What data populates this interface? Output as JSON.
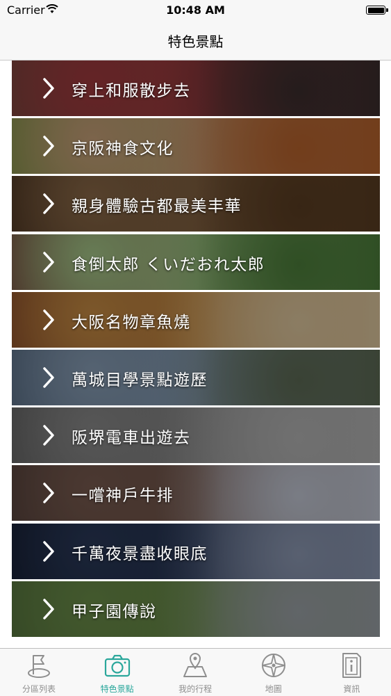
{
  "status_bar": {
    "carrier": "Carrier",
    "time": "10:48 AM"
  },
  "nav_bar": {
    "title": "特色景點"
  },
  "attractions": [
    {
      "label": "穿上和服散步去",
      "colors": [
        "#6f4a3d",
        "#a23a3e",
        "#3c2e2e"
      ]
    },
    {
      "label": "京阪神食文化",
      "colors": [
        "#6e8f3b",
        "#c9a27a",
        "#b8632d"
      ]
    },
    {
      "label": "親身體驗古都最美丰華",
      "colors": [
        "#3a2618",
        "#8c6a48",
        "#5a3d22"
      ]
    },
    {
      "label": "食倒太郎 くいだおれ太郎",
      "colors": [
        "#6b2b2b",
        "#a7c98a",
        "#4d7f3b"
      ]
    },
    {
      "label": "大阪名物章魚燒",
      "colors": [
        "#7a3b22",
        "#c98e45",
        "#e0c9a0"
      ]
    },
    {
      "label": "萬城目學景點遊歷",
      "colors": [
        "#4a5e76",
        "#8aa0b8",
        "#5d6b55"
      ]
    },
    {
      "label": "阪堺電車出遊去",
      "colors": [
        "#565656",
        "#8c8c8c",
        "#b5b5b5"
      ]
    },
    {
      "label": "一嚐神戶牛排",
      "colors": [
        "#4a3a36",
        "#7a5c50",
        "#c4c9d6"
      ]
    },
    {
      "label": "千萬夜景盡收眼底",
      "colors": [
        "#0f1628",
        "#2b3a5a",
        "#8f9bb5"
      ]
    },
    {
      "label": "甲子園傳說",
      "colors": [
        "#4f6b3a",
        "#6c8f4a",
        "#9da3a8"
      ]
    }
  ],
  "tabs": [
    {
      "label": "分區列表",
      "icon": "flag-icon",
      "active": false
    },
    {
      "label": "特色景點",
      "icon": "camera-icon",
      "active": true
    },
    {
      "label": "我的行程",
      "icon": "map-pin-icon",
      "active": false
    },
    {
      "label": "地圖",
      "icon": "compass-icon",
      "active": false
    },
    {
      "label": "資訊",
      "icon": "info-icon",
      "active": false
    }
  ],
  "colors": {
    "accent": "#2aa79b",
    "inactive": "#8e8e8e"
  }
}
